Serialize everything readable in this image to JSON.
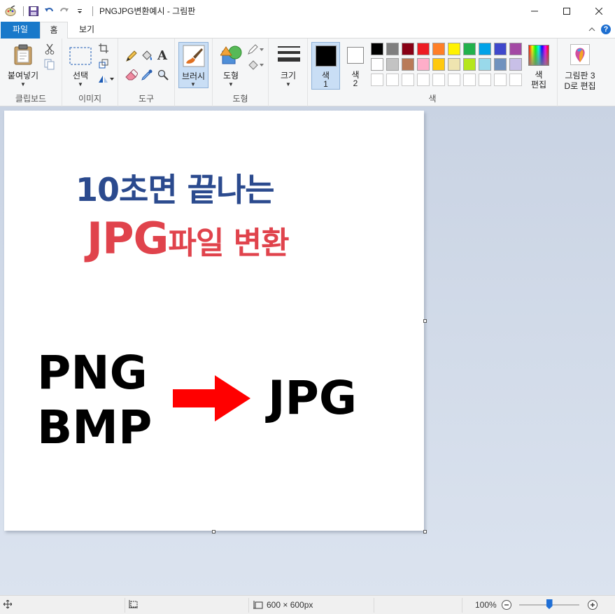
{
  "window": {
    "title": "PNGJPG변환예시 - 그림판"
  },
  "tabs": {
    "file": "파일",
    "home": "홈",
    "view": "보기"
  },
  "ribbon": {
    "clipboard": {
      "paste": "붙여넣기",
      "group": "클립보드"
    },
    "image": {
      "select": "선택",
      "group": "이미지"
    },
    "tools": {
      "group": "도구"
    },
    "brush": {
      "label": "브러시"
    },
    "shapes": {
      "label": "도형",
      "group": "도형"
    },
    "size": {
      "label": "크기"
    },
    "colors": {
      "color1_line1": "색",
      "color1_line2": "1",
      "color2_line1": "색",
      "color2_line2": "2",
      "edit_line1": "색",
      "edit_line2": "편집",
      "group": "색",
      "color1_value": "#000000",
      "color2_value": "#ffffff",
      "palette_row1": [
        "#000000",
        "#7f7f7f",
        "#880015",
        "#ed1c24",
        "#ff7f27",
        "#fff200",
        "#22b14c",
        "#00a2e8",
        "#3f48cc",
        "#a349a4"
      ],
      "palette_row2": [
        "#ffffff",
        "#c3c3c3",
        "#b97a57",
        "#ffaec9",
        "#ffc90e",
        "#efe4b0",
        "#b5e61d",
        "#99d9ea",
        "#7092be",
        "#c8bfe7"
      ]
    },
    "paint3d": {
      "line1": "그림판 3",
      "line2": "D로 편집"
    }
  },
  "canvas": {
    "headline1": "10초면 끝나는",
    "headline2_a": "JPG",
    "headline2_b": "파일 변환",
    "src1": "PNG",
    "src2": "BMP",
    "dest": "JPG",
    "colors": {
      "headline1": "#2b4a8e",
      "headline2": "#e0434c",
      "arrow": "#ff0000",
      "body_text": "#000000"
    }
  },
  "status": {
    "dimensions": "600 × 600px",
    "zoom": "100%",
    "zoom_fraction": 0.5
  }
}
